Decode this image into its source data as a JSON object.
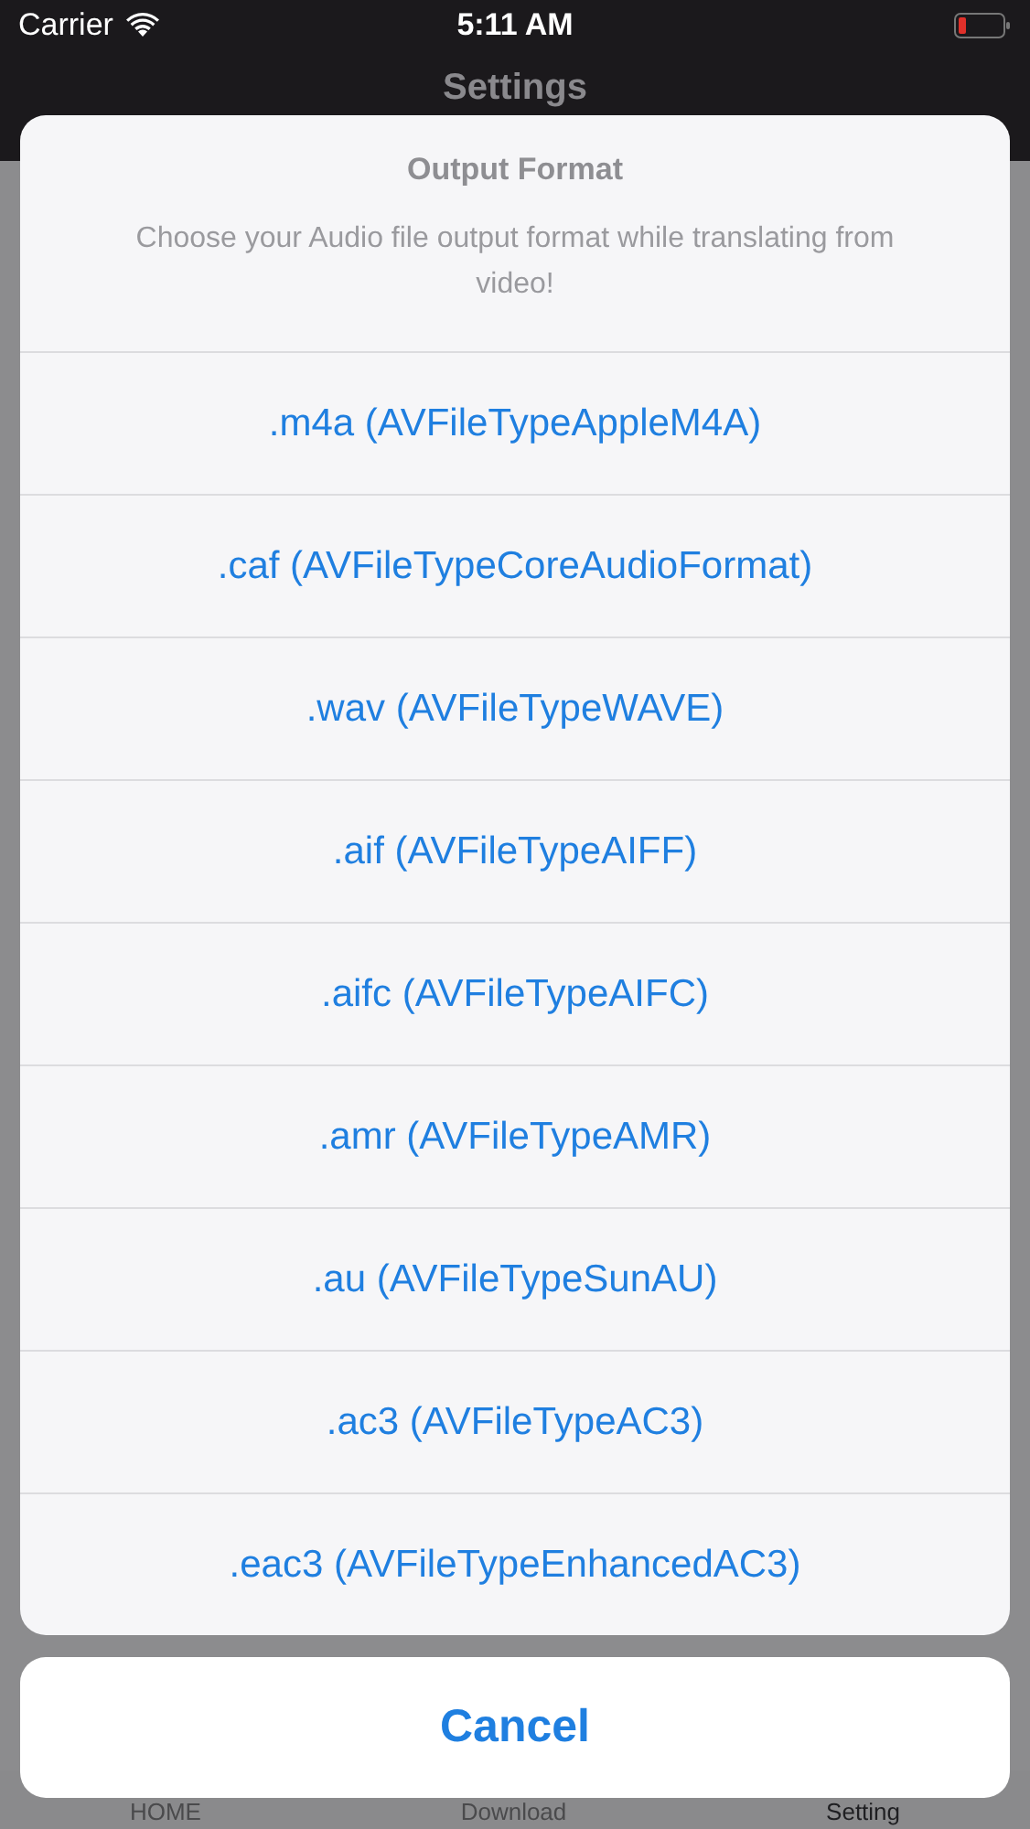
{
  "status_bar": {
    "carrier": "Carrier",
    "time": "5:11 AM"
  },
  "nav_bar": {
    "title": "Settings"
  },
  "tab_bar": {
    "items": [
      {
        "label": "HOME",
        "selected": false
      },
      {
        "label": "Download",
        "selected": false
      },
      {
        "label": "Setting",
        "selected": true
      }
    ]
  },
  "action_sheet": {
    "title": "Output Format",
    "message": "Choose your Audio file output format while translating from video!",
    "actions": [
      ".m4a (AVFileTypeAppleM4A)",
      ".caf (AVFileTypeCoreAudioFormat)",
      ".wav (AVFileTypeWAVE)",
      ".aif (AVFileTypeAIFF)",
      ".aifc (AVFileTypeAIFC)",
      ".amr (AVFileTypeAMR)",
      ".au (AVFileTypeSunAU)",
      ".ac3 (AVFileTypeAC3)",
      ".eac3 (AVFileTypeEnhancedAC3)"
    ],
    "cancel": "Cancel"
  }
}
